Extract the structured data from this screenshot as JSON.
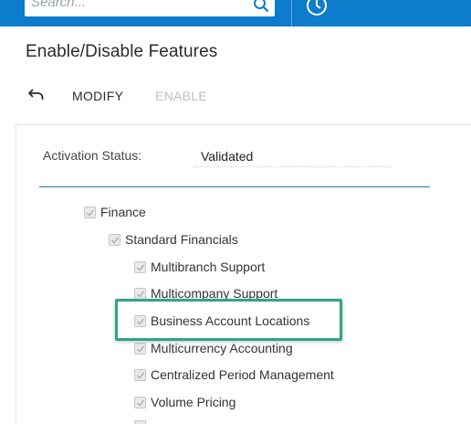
{
  "topbar": {
    "search_placeholder": "Search...",
    "search_icon": "search-icon",
    "history_icon": "history-icon",
    "color": "#0e7ccc"
  },
  "page": {
    "title": "Enable/Disable Features"
  },
  "toolbar": {
    "undo_icon": "undo-icon",
    "modify_label": "MODIFY",
    "enable_label": "ENABLE"
  },
  "activation": {
    "label": "Activation Status:",
    "value": "Validated"
  },
  "features": [
    {
      "label": "Finance",
      "checked": true,
      "disabled": true
    },
    {
      "label": "Standard Financials",
      "checked": true,
      "disabled": true
    },
    {
      "label": "Multibranch Support",
      "checked": true,
      "disabled": true
    },
    {
      "label": "Multicompany Support",
      "checked": true,
      "disabled": true
    },
    {
      "label": "Business Account Locations",
      "checked": true,
      "disabled": true,
      "highlighted": true
    },
    {
      "label": "Multicurrency Accounting",
      "checked": true,
      "disabled": true
    },
    {
      "label": "Centralized Period Management",
      "checked": true,
      "disabled": true
    },
    {
      "label": "Volume Pricing",
      "checked": true,
      "disabled": true
    }
  ],
  "colors": {
    "highlight_border": "#31a489",
    "separator": "#2a7aa0",
    "disabled_text": "#bfbfbf"
  }
}
